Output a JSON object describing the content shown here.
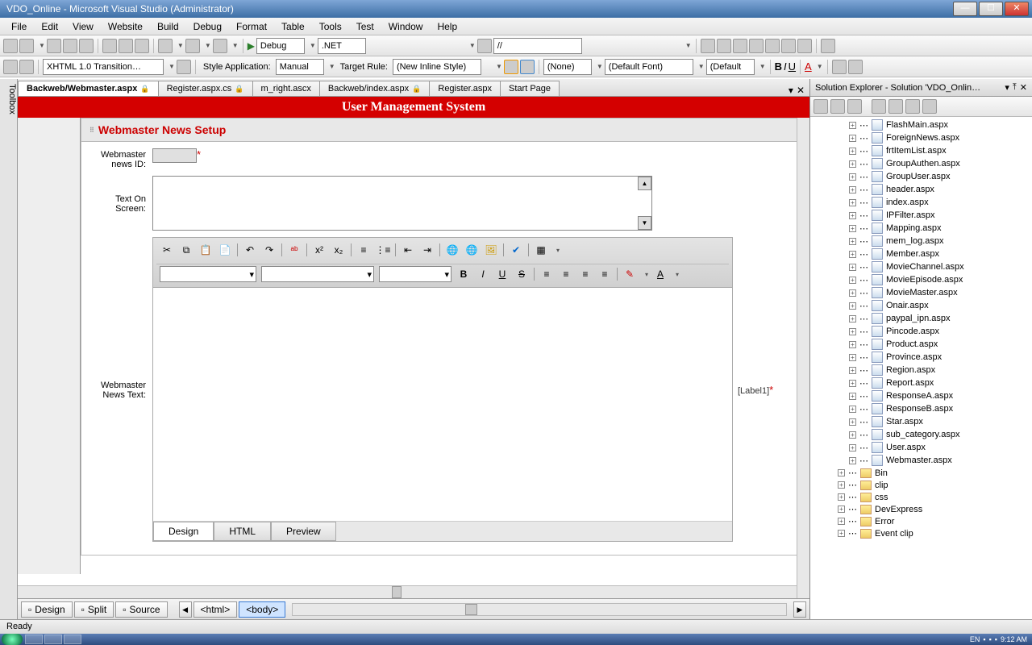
{
  "titlebar": {
    "title": "VDO_Online - Microsoft Visual Studio (Administrator)"
  },
  "menu": [
    "File",
    "Edit",
    "View",
    "Website",
    "Build",
    "Debug",
    "Format",
    "Table",
    "Tools",
    "Test",
    "Window",
    "Help"
  ],
  "toolbar1": {
    "config": "Debug",
    "platform": ".NET",
    "search": "//"
  },
  "toolbar2": {
    "doctype": "XHTML 1.0 Transition…",
    "style_app_label": "Style Application:",
    "style_app_value": "Manual",
    "target_rule_label": "Target Rule:",
    "target_rule_value": "(New Inline Style)",
    "css_class": "(None)",
    "font": "(Default Font)",
    "size": "(Default"
  },
  "tabs": [
    {
      "label": "Backweb/Webmaster.aspx",
      "active": true,
      "lock": true
    },
    {
      "label": "Register.aspx.cs",
      "active": false,
      "lock": true
    },
    {
      "label": "m_right.ascx",
      "active": false,
      "lock": false
    },
    {
      "label": "Backweb/index.aspx",
      "active": false,
      "lock": true
    },
    {
      "label": "Register.aspx",
      "active": false,
      "lock": false
    },
    {
      "label": "Start Page",
      "active": false,
      "lock": false
    }
  ],
  "ums": {
    "header": "User Management System",
    "panel_title": "Webmaster News Setup",
    "lbl_id": "Webmaster news ID:",
    "lbl_text_on_screen": "Text On Screen:",
    "lbl_news_text": "Webmaster News Text:",
    "label1": "[Label1]",
    "editor_tabs": [
      "Design",
      "HTML",
      "Preview"
    ]
  },
  "viewmodes": {
    "design": "Design",
    "split": "Split",
    "source": "Source"
  },
  "breadcrumb": [
    "<html>",
    "<body>"
  ],
  "solution": {
    "title": "Solution Explorer - Solution 'VDO_Onlin…",
    "files": [
      "FlashMain.aspx",
      "ForeignNews.aspx",
      "frtItemList.aspx",
      "GroupAuthen.aspx",
      "GroupUser.aspx",
      "header.aspx",
      "index.aspx",
      "IPFilter.aspx",
      "Mapping.aspx",
      "mem_log.aspx",
      "Member.aspx",
      "MovieChannel.aspx",
      "MovieEpisode.aspx",
      "MovieMaster.aspx",
      "Onair.aspx",
      "paypal_ipn.aspx",
      "Pincode.aspx",
      "Product.aspx",
      "Province.aspx",
      "Region.aspx",
      "Report.aspx",
      "ResponseA.aspx",
      "ResponseB.aspx",
      "Star.aspx",
      "sub_category.aspx",
      "User.aspx",
      "Webmaster.aspx"
    ],
    "folders": [
      "Bin",
      "clip",
      "css",
      "DevExpress",
      "Error",
      "Event clip"
    ]
  },
  "status": "Ready",
  "tray": {
    "lang": "EN",
    "time": "9:12 AM"
  },
  "toolbox_label": "Toolbox"
}
